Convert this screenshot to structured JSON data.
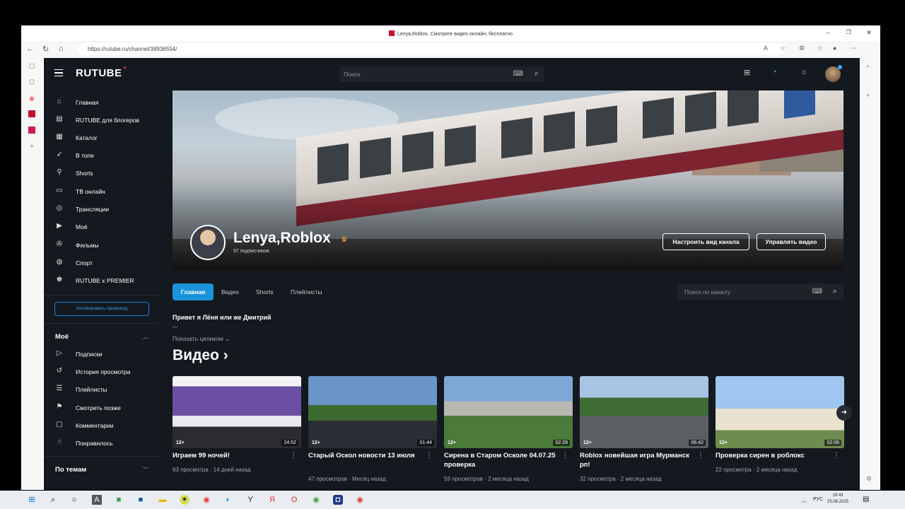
{
  "browser": {
    "window_title": "Lenya,Roblox, Смотрите видео онлайн, бесплатно",
    "url": "https://rutube.ru/channel/38936554/"
  },
  "header": {
    "logo": "RUTUBE",
    "search_placeholder": "Поиск"
  },
  "sidebar": {
    "items": [
      {
        "label": "Главная",
        "icon": "home-icon"
      },
      {
        "label": "RUTUBE для блогеров",
        "icon": "rutube-blog-icon"
      },
      {
        "label": "Каталог",
        "icon": "grid-icon"
      },
      {
        "label": "В топе",
        "icon": "rocket-icon"
      },
      {
        "label": "Shorts",
        "icon": "shorts-icon"
      },
      {
        "label": "ТВ онлайн",
        "icon": "tv-icon"
      },
      {
        "label": "Трансляции",
        "icon": "broadcast-icon"
      },
      {
        "label": "Моё",
        "icon": "play-square-icon"
      },
      {
        "label": "Фильмы",
        "icon": "film-icon"
      },
      {
        "label": "Спорт",
        "icon": "sport-icon"
      },
      {
        "label": "RUTUBE x PREMIER",
        "icon": "premier-icon"
      }
    ],
    "promo_button": "Активировать промокод",
    "my_section": "Моё",
    "my_items": [
      {
        "label": "Подписки",
        "icon": "subscriptions-icon"
      },
      {
        "label": "История просмотра",
        "icon": "history-icon"
      },
      {
        "label": "Плейлисты",
        "icon": "playlist-icon"
      },
      {
        "label": "Смотреть позже",
        "icon": "bookmark-icon"
      },
      {
        "label": "Комментарии",
        "icon": "comment-icon"
      },
      {
        "label": "Понравилось",
        "icon": "thumbs-up-icon"
      }
    ],
    "topics_section": "По темам"
  },
  "channel": {
    "name": "Lenya,Roblox",
    "subscribers": "97 подписчиков",
    "customize_button": "Настроить вид канала",
    "manage_button": "Управлять видео",
    "tabs": [
      "Главная",
      "Видео",
      "Shorts",
      "Плейлисты"
    ],
    "active_tab": "Главная",
    "search_placeholder": "Поиск по каналу",
    "description_line1": "Привет я Лёня или же Дмитрий",
    "description_line2": "...",
    "show_more": "Показать целиком"
  },
  "videos_section": {
    "title": "Видео",
    "videos": [
      {
        "title": "Играем 99 ночей!",
        "age": "12+",
        "duration": "24:52",
        "views": "63 просмотра",
        "date": "14 дней назад"
      },
      {
        "title": "Старый Оскол новости 13 июля",
        "age": "12+",
        "duration": "01:44",
        "views": "47 просмотров",
        "date": "Месяц назад"
      },
      {
        "title": "Сирена в Старом Осколе 04.07.25 проверка",
        "age": "12+",
        "duration": "02:28",
        "views": "59 просмотров",
        "date": "2 месяца назад"
      },
      {
        "title": "Roblox новейшая игра Мурманск рп!",
        "age": "12+",
        "duration": "06:42",
        "views": "32 просмотра",
        "date": "2 месяца назад"
      },
      {
        "title": "Проверка сирен в роблокс",
        "age": "12+",
        "duration": "02:06",
        "views": "22 просмотра",
        "date": "2 месяца назад"
      }
    ]
  },
  "taskbar": {
    "lang": "РУС",
    "time": "19:43",
    "date": "25.08.2025"
  }
}
